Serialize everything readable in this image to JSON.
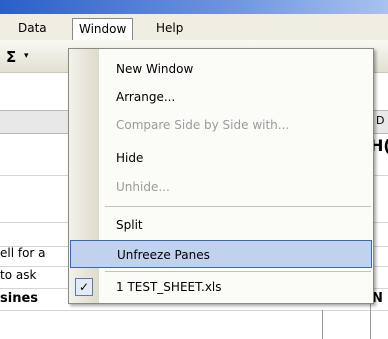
{
  "menubar": {
    "items": [
      {
        "id": "data",
        "label": "Data"
      },
      {
        "id": "window",
        "label": "Window"
      },
      {
        "id": "help",
        "label": "Help"
      }
    ]
  },
  "toolbar": {
    "autosum_symbol": "Σ",
    "autosum_arrow": "▾",
    "overflow_arrow": "▾"
  },
  "sheet": {
    "column_header_right": "D",
    "heading_fragment": "H(",
    "row_text_1": "ell for a",
    "row_text_2": "to ask",
    "header_left": "sines",
    "header_right": "N"
  },
  "window_menu": {
    "new_window": "New Window",
    "arrange": "Arrange...",
    "compare": "Compare Side by Side with...",
    "hide": "Hide",
    "unhide": "Unhide...",
    "split": "Split",
    "unfreeze": "Unfreeze Panes",
    "recent_file": "1 TEST_SHEET.xls",
    "check_mark": "✓"
  },
  "colors": {
    "highlight_bg": "#c1d2ee",
    "highlight_border": "#316ac5",
    "menubar_bg": "#f0eee2"
  }
}
